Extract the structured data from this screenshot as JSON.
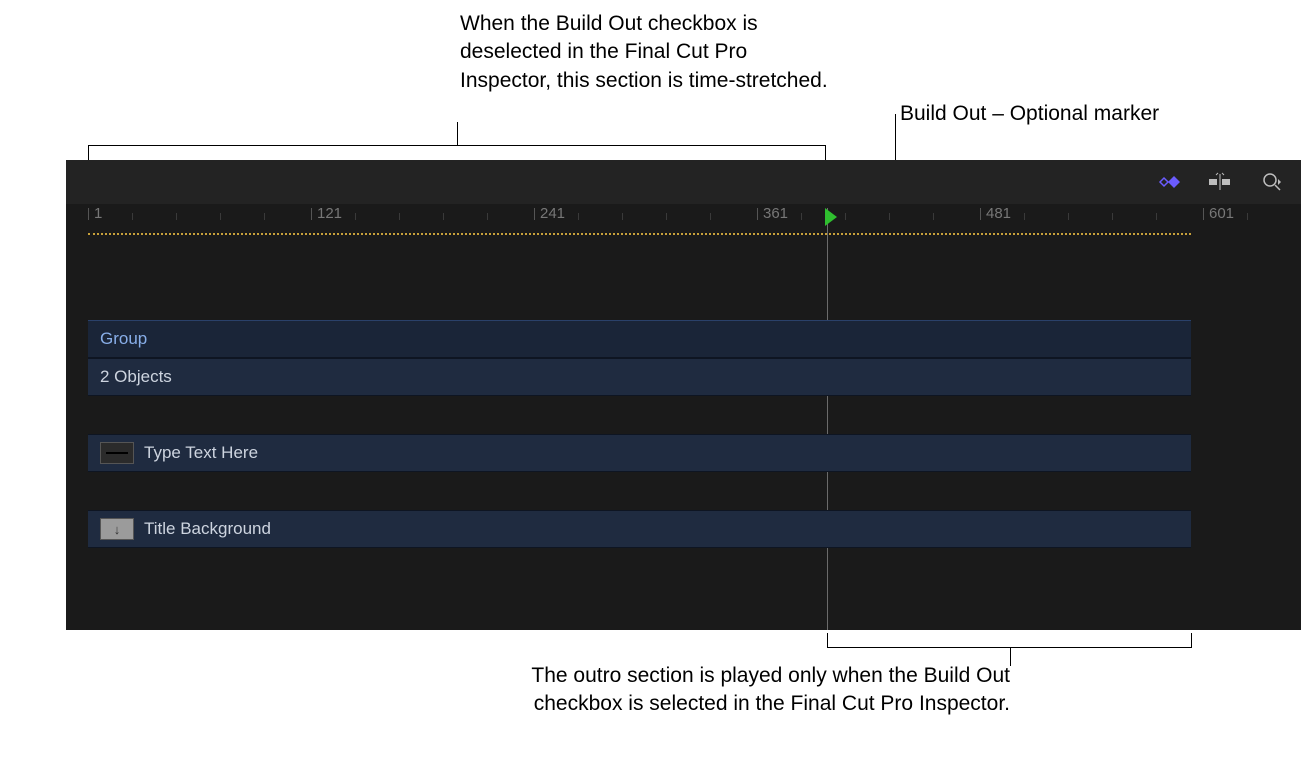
{
  "annotations": {
    "top_left": "When the Build Out checkbox is deselected in the Final Cut Pro Inspector, this section is time-stretched.",
    "top_right": "Build Out – Optional marker",
    "bottom": "The outro section is played only when the Build Out checkbox is selected in the Final Cut Pro Inspector."
  },
  "ruler": {
    "labels": [
      "1",
      "121",
      "241",
      "361",
      "481",
      "601"
    ]
  },
  "tracks": {
    "group_label": "Group",
    "objects_label": "2 Objects",
    "text_layer": "Type Text Here",
    "bg_layer": "Title Background"
  },
  "icons": {
    "keyframe": "keyframe-icon",
    "snap": "snap-icon",
    "zoom": "zoom-icon"
  },
  "colors": {
    "accent": "#6b5cff",
    "playhead": "#2fbf2f",
    "dotted": "#c8a13a"
  }
}
